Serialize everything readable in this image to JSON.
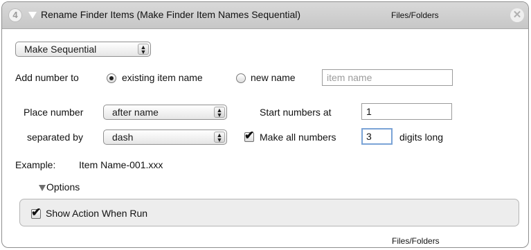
{
  "header": {
    "step_number": "4",
    "title": "Rename Finder Items (Make Finder Item Names Sequential)",
    "category": "Files/Folders",
    "close_glyph": "✕"
  },
  "mode_popup": {
    "value": "Make Sequential",
    "arrows": "▲▼"
  },
  "add_number": {
    "label": "Add number to",
    "option_existing": "existing item name",
    "option_new": "new name",
    "selected": "existing item name",
    "new_name_placeholder": "item name",
    "new_name_value": ""
  },
  "place_number": {
    "label": "Place number",
    "value": "after name"
  },
  "separated_by": {
    "label": "separated by",
    "value": "dash"
  },
  "start_numbers": {
    "label": "Start numbers at",
    "value": "1"
  },
  "digits": {
    "checkbox_label": "Make all numbers",
    "checked": true,
    "value": "3",
    "suffix": "digits long"
  },
  "example": {
    "label": "Example:",
    "value": "Item Name-001.xxx"
  },
  "options": {
    "label": "Options",
    "show_action_label": "Show Action When Run",
    "show_action_checked": true
  },
  "footer": {
    "category": "Files/Folders"
  },
  "icons": {
    "check": "✔"
  },
  "colors": {
    "titlebar": "#cfcfcf",
    "focus_ring": "#7aa3d6",
    "border": "#8e8e8e"
  }
}
